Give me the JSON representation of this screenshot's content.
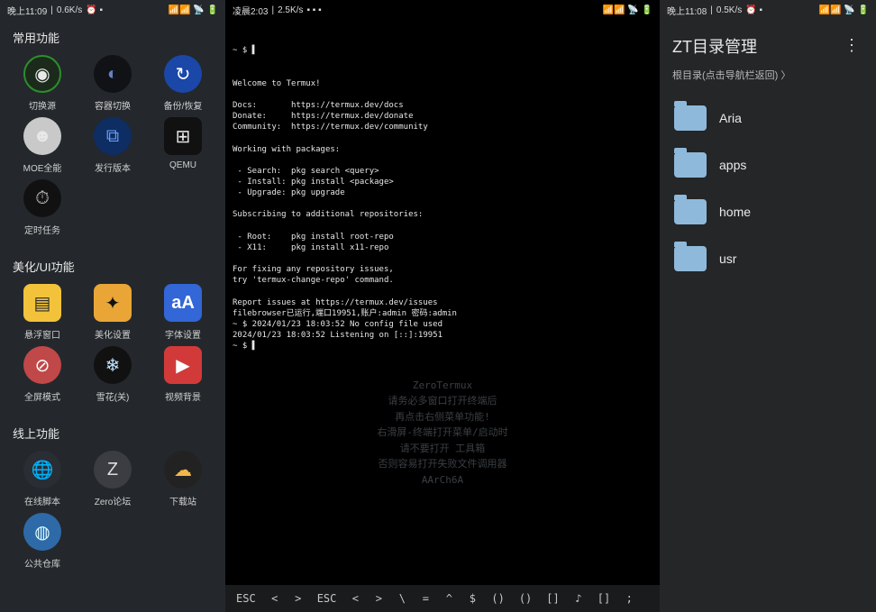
{
  "status": {
    "left": {
      "time": "晚上11:09",
      "net": "0.6K/s",
      "icons": "⏰ ▪"
    },
    "mid": {
      "time": "凌晨2:03",
      "net": "2.5K/s",
      "icons": "▪ ▪ ▪"
    },
    "right": {
      "time": "晚上11:08",
      "net": "0.5K/s",
      "icons": "⏰ ▪"
    },
    "right_icons": "📶📶 📡 🔋"
  },
  "left": {
    "sections": [
      {
        "title": "常用功能",
        "items": [
          {
            "label": "切换源",
            "glyph": "◉",
            "cls": "ic-ring"
          },
          {
            "label": "容器切换",
            "glyph": "◐",
            "cls": "ic-dark"
          },
          {
            "label": "备份/恢复",
            "glyph": "↻",
            "cls": "ic-blue"
          },
          {
            "label": "MOE全能",
            "glyph": "☻",
            "cls": "ic-avatar"
          },
          {
            "label": "发行版本",
            "glyph": "⧉",
            "cls": "ic-cube"
          },
          {
            "label": "QEMU",
            "glyph": "⊞",
            "cls": "ic-win"
          },
          {
            "label": "定时任务",
            "glyph": "⏱",
            "cls": "ic-clock"
          }
        ]
      },
      {
        "title": "美化/UI功能",
        "items": [
          {
            "label": "悬浮窗口",
            "glyph": "▤",
            "cls": "ic-note"
          },
          {
            "label": "美化设置",
            "glyph": "✦",
            "cls": "ic-wand"
          },
          {
            "label": "字体设置",
            "glyph": "aA",
            "cls": "ic-aA"
          },
          {
            "label": "全屏模式",
            "glyph": "⊘",
            "cls": "ic-no"
          },
          {
            "label": "雪花(关)",
            "glyph": "❄",
            "cls": "ic-snow"
          },
          {
            "label": "视频背景",
            "glyph": "▶",
            "cls": "ic-play"
          }
        ]
      },
      {
        "title": "线上功能",
        "items": [
          {
            "label": "在线脚本",
            "glyph": "🌐",
            "cls": "ic-globe"
          },
          {
            "label": "Zero论坛",
            "glyph": "Z",
            "cls": "ic-zero"
          },
          {
            "label": "下载站",
            "glyph": "☁",
            "cls": "ic-cloud"
          },
          {
            "label": "公共仓库",
            "glyph": "◍",
            "cls": "ic-repo"
          }
        ]
      }
    ]
  },
  "terminal": {
    "prompt_top": "~ $ ▌",
    "lines": [
      "Welcome to Termux!",
      "",
      "Docs:       https://termux.dev/docs",
      "Donate:     https://termux.dev/donate",
      "Community:  https://termux.dev/community",
      "",
      "Working with packages:",
      "",
      " - Search:  pkg search <query>",
      " - Install: pkg install <package>",
      " - Upgrade: pkg upgrade",
      "",
      "Subscribing to additional repositories:",
      "",
      " - Root:    pkg install root-repo",
      " - X11:     pkg install x11-repo",
      "",
      "For fixing any repository issues,",
      "try 'termux-change-repo' command.",
      "",
      "Report issues at https://termux.dev/issues",
      "filebrowser已运行,端口19951,账户:admin 密码:admin",
      "~ $ 2024/01/23 18:03:52 No config file used",
      "2024/01/23 18:03:52 Listening on [::]:19951",
      "~ $ ▌"
    ],
    "ghost": "ZeroTermux\n请务必多窗口打开终端后\n再点击右侧菜单功能!\n右滑屏-终端打开菜单/启动时\n请不要打开 工具箱\n否则容易打开失败文件调用器\nAArCh6A",
    "keys": [
      "ESC",
      "<",
      ">",
      "ESC",
      "<",
      ">",
      "\\",
      "=",
      "^",
      "$",
      "()",
      "()",
      "[]",
      "♪",
      "[]",
      ";"
    ]
  },
  "filemanager": {
    "title": "ZT目录管理",
    "breadcrumb": "根目录(点击导航栏返回)  〉",
    "folders": [
      "Aria",
      "apps",
      "home",
      "usr"
    ]
  }
}
